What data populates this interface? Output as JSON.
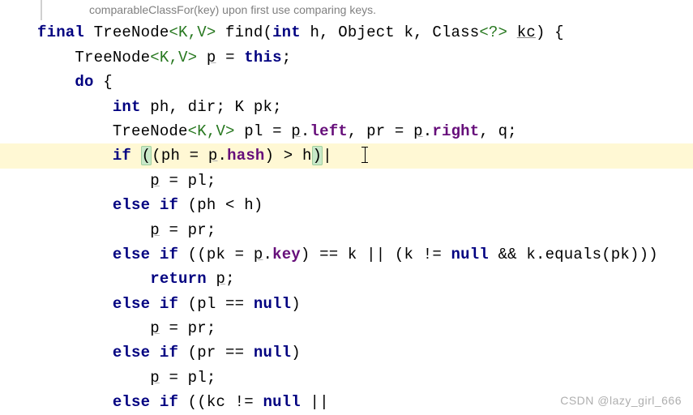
{
  "doc_comment": "comparableClassFor(key) upon first use comparing keys.",
  "code_lines": {
    "l1_a": "final",
    "l1_b": " TreeNode",
    "l1_c": "<K,V>",
    "l1_d": " find(",
    "l1_e": "int",
    "l1_f": " h, Object k, Class",
    "l1_g": "<?>",
    "l1_h": " ",
    "l1_i": "kc",
    "l1_j": ") {",
    "l2_a": "    TreeNode",
    "l2_b": "<K,V>",
    "l2_c": " ",
    "l2_d": "p",
    "l2_e": " = ",
    "l2_f": "this",
    "l2_g": ";",
    "l3_a": "    ",
    "l3_b": "do",
    "l3_c": " {",
    "l4_a": "        ",
    "l4_b": "int",
    "l4_c": " ph, dir; K pk;",
    "l5_a": "        TreeNode",
    "l5_b": "<K,V>",
    "l5_c": " pl = ",
    "l5_d": "p",
    "l5_e": ".",
    "l5_f": "left",
    "l5_g": ", pr = ",
    "l5_h": "p",
    "l5_i": ".",
    "l5_j": "right",
    "l5_k": ", q;",
    "l6_a": "        ",
    "l6_b": "if",
    "l6_c": " ",
    "l6_d": "(",
    "l6_e": "(ph = ",
    "l6_f": "p",
    "l6_g": ".",
    "l6_h": "hash",
    "l6_i": ") > h",
    "l6_j": ")",
    "l7_a": "            ",
    "l7_b": "p",
    "l7_c": " = pl;",
    "l8_a": "        ",
    "l8_b": "else if",
    "l8_c": " (ph < h)",
    "l9_a": "            ",
    "l9_b": "p",
    "l9_c": " = pr;",
    "l10_a": "        ",
    "l10_b": "else if",
    "l10_c": " ((pk = ",
    "l10_d": "p",
    "l10_e": ".",
    "l10_f": "key",
    "l10_g": ") == k || (k != ",
    "l10_h": "null",
    "l10_i": " && k.equals(pk)))",
    "l11_a": "            ",
    "l11_b": "return",
    "l11_c": " ",
    "l11_d": "p",
    "l11_e": ";",
    "l12_a": "        ",
    "l12_b": "else if",
    "l12_c": " (pl == ",
    "l12_d": "null",
    "l12_e": ")",
    "l13_a": "            ",
    "l13_b": "p",
    "l13_c": " = pr;",
    "l14_a": "        ",
    "l14_b": "else if",
    "l14_c": " (pr == ",
    "l14_d": "null",
    "l14_e": ")",
    "l15_a": "            ",
    "l15_b": "p",
    "l15_c": " = pl;",
    "l16_a": "        ",
    "l16_b": "else if",
    "l16_c": " ((kc != ",
    "l16_d": "null",
    "l16_e": " ||"
  },
  "watermark": "CSDN @lazy_girl_666",
  "cursor_char": "|"
}
